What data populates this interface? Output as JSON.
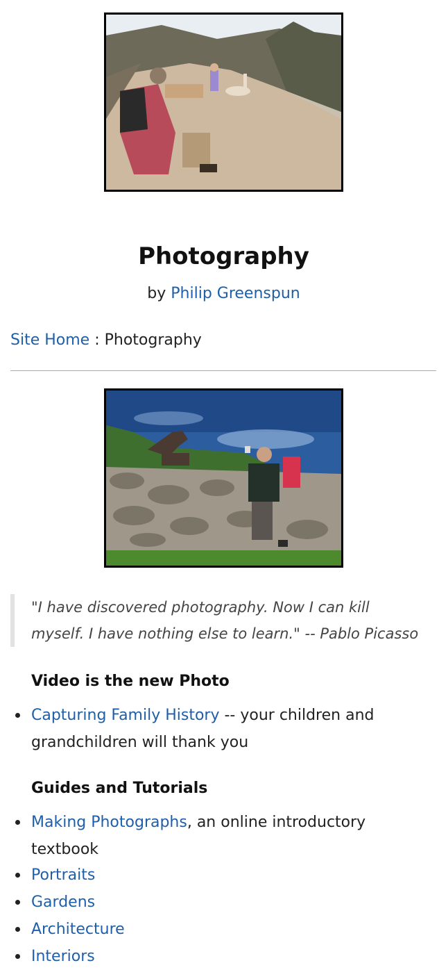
{
  "header": {
    "title": "Photography",
    "byline_prefix": "by ",
    "author_link": "Philip Greenspun"
  },
  "breadcrumb": {
    "home_link": "Site Home",
    "separator": " : ",
    "current": "Photography"
  },
  "quote": {
    "text": "\"I have discovered photography. Now I can kill myself. I have nothing else to learn.\" -- Pablo Picasso"
  },
  "sections": {
    "video": {
      "heading": "Video is the new Photo",
      "items": [
        {
          "link": "Capturing Family History",
          "rest": " -- your children and grandchildren will thank you"
        }
      ]
    },
    "guides": {
      "heading": "Guides and Tutorials",
      "items": [
        {
          "link": "Making Photographs",
          "rest": ", an online introductory textbook"
        }
      ]
    },
    "topics": {
      "items": [
        "Portraits",
        "Gardens",
        "Architecture",
        "Interiors"
      ]
    }
  },
  "colors": {
    "link": "#1f5fa8",
    "text": "#222222",
    "quote_border": "#e2e2e2"
  }
}
